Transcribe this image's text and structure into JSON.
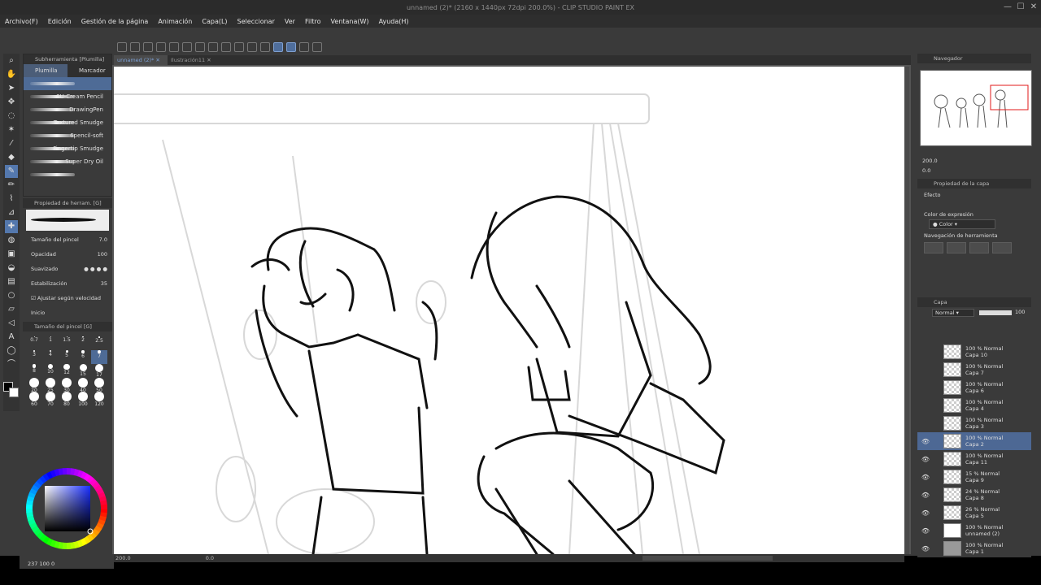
{
  "window": {
    "title": "unnamed (2)* (2160 x 1440px 72dpi 200.0%) - CLIP STUDIO PAINT EX",
    "controls": [
      "—",
      "☐",
      "✕"
    ]
  },
  "menu": [
    "Archivo(F)",
    "Edición",
    "Gestión de la página",
    "Animación",
    "Capa(L)",
    "Seleccionar",
    "Ver",
    "Filtro",
    "Ventana(W)",
    "Ayuda(H)"
  ],
  "doc_tabs": [
    {
      "label": "unnamed (2)*",
      "active": true
    },
    {
      "label": "Ilustración11",
      "active": false
    }
  ],
  "subtool": {
    "panel_title": "Subherramienta [Plumilla]",
    "tabs": [
      "Plumilla",
      "Marcador"
    ],
    "brushes": [
      "",
      "SU-Cream Pencil",
      "DrawingPen",
      "Textured Smudge",
      "6pencil-soft",
      "Fingertip Smudge",
      "Super Dry Oil",
      ""
    ],
    "selected_index": 0
  },
  "tool_property": {
    "panel_title": "Propiedad de herram. [G]",
    "brush_size_label": "Tamaño del pincel",
    "brush_size_value": "7.0",
    "opacity_label": "Opacidad",
    "opacity_value": "100",
    "smoothing_label": "Suavizado",
    "stabilization_label": "Estabilización",
    "stabilization_value": "35",
    "speed_label": "Ajustar según velocidad",
    "ink_label": "Inicio"
  },
  "brush_size_panel": {
    "panel_title": "Tamaño del pincel [G]",
    "sizes": [
      "0.7",
      "1",
      "1.5",
      "2",
      "2.5",
      "3",
      "4",
      "5",
      "6",
      "7",
      "8",
      "10",
      "12",
      "15",
      "17",
      "20",
      "25",
      "30",
      "40",
      "50",
      "60",
      "70",
      "80",
      "100",
      "120"
    ],
    "selected": "7"
  },
  "color": {
    "main": "#000000",
    "sub": "#ffffff",
    "square_hue": "#1a2fff",
    "readout": "237",
    "readout_2": "100",
    "readout_3": "0"
  },
  "status": {
    "zoom": "200.0",
    "angle": "0.0"
  },
  "navigator": {
    "panel_title": "Navegador",
    "zoom": "200.0",
    "rotation": "0.0"
  },
  "layer_property": {
    "panel_title": "Propiedad de la capa",
    "effect_label": "Efecto",
    "expression_label": "Color de expresión",
    "expression_value": "Color",
    "nav_label": "Navegación de herramienta"
  },
  "layers": {
    "panel_title": "Capa",
    "blend_mode": "Normal",
    "opacity": "100",
    "items": [
      {
        "opacity": "100 %",
        "mode": "Normal",
        "name": "Capa 10",
        "visible": false,
        "thumb": "checker"
      },
      {
        "opacity": "100 %",
        "mode": "Normal",
        "name": "Capa 7",
        "visible": false,
        "thumb": "checker"
      },
      {
        "opacity": "100 %",
        "mode": "Normal",
        "name": "Capa 6",
        "visible": false,
        "thumb": "checker"
      },
      {
        "opacity": "100 %",
        "mode": "Normal",
        "name": "Capa 4",
        "visible": false,
        "thumb": "checker"
      },
      {
        "opacity": "100 %",
        "mode": "Normal",
        "name": "Capa 3",
        "visible": false,
        "thumb": "checker"
      },
      {
        "opacity": "100 %",
        "mode": "Normal",
        "name": "Capa 2",
        "visible": true,
        "thumb": "checker",
        "selected": true
      },
      {
        "opacity": "100 %",
        "mode": "Normal",
        "name": "Capa 11",
        "visible": true,
        "thumb": "checker"
      },
      {
        "opacity": "15 %",
        "mode": "Normal",
        "name": "Capa 9",
        "visible": true,
        "thumb": "checker"
      },
      {
        "opacity": "24 %",
        "mode": "Normal",
        "name": "Capa 8",
        "visible": true,
        "thumb": "checker"
      },
      {
        "opacity": "26 %",
        "mode": "Normal",
        "name": "Capa 5",
        "visible": true,
        "thumb": "checker"
      },
      {
        "opacity": "100 %",
        "mode": "Normal",
        "name": "unnamed (2)",
        "visible": true,
        "thumb": "white"
      },
      {
        "opacity": "100 %",
        "mode": "Normal",
        "name": "Capa 1",
        "visible": true,
        "thumb": "grey"
      }
    ]
  },
  "tools": [
    "zoom-icon",
    "hand-icon",
    "eyedropper-icon",
    "move-icon",
    "lasso-icon",
    "magic-wand-icon",
    "eyedropper-icon",
    "eraser-icon",
    "pen-icon",
    "pencil-icon",
    "brush-icon",
    "airbrush-icon",
    "decoration-icon",
    "blend-icon",
    "fill-icon",
    "gradient-icon",
    "figure-icon",
    "frame-icon",
    "ruler-icon",
    "text-icon",
    "balloon-icon",
    "correct-line-icon"
  ]
}
